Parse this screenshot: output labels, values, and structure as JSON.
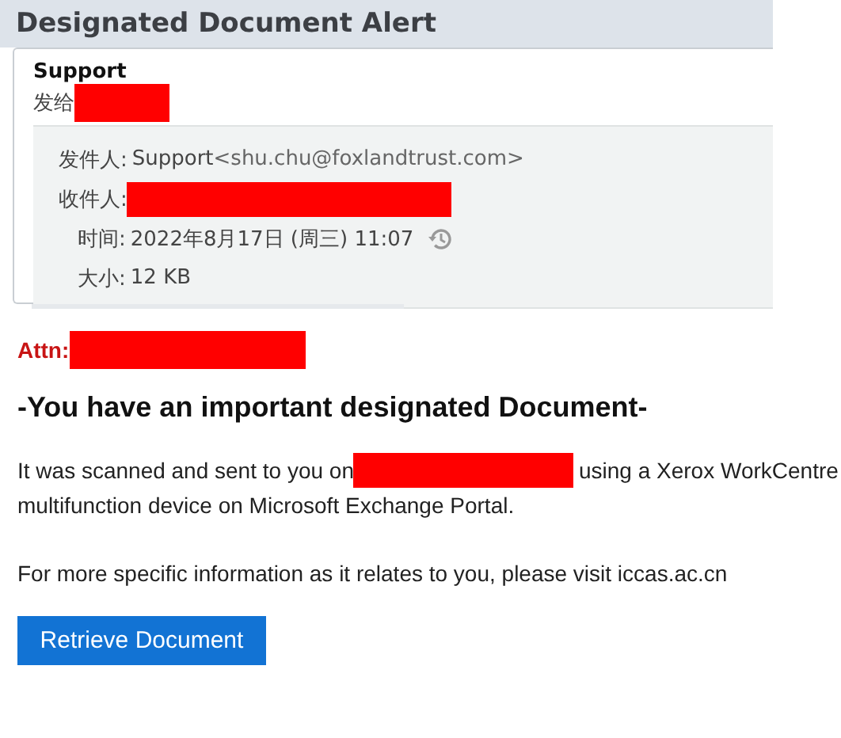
{
  "subject": "Designated Document Alert",
  "sender_name": "Support",
  "to_label": "发给",
  "details": [
    {
      "kind": "from",
      "label": "发件人:",
      "value": "Support",
      "extra": "<shu.chu@foxlandtrust.com>"
    },
    {
      "kind": "redacted",
      "label": "收件人:"
    },
    {
      "kind": "time",
      "label": "时间:",
      "value": "2022年8月17日 (周三) 11:07"
    },
    {
      "kind": "plain",
      "label": "大小:",
      "value": "12 KB"
    }
  ],
  "body": {
    "attn_label": "Attn:",
    "heading": "-You have an important designated Document-",
    "scan_before": "It was scanned and sent to you on",
    "scan_after": "using a Xerox WorkCentre",
    "scan_line2": "multifunction device on Microsoft Exchange Portal.",
    "info": "For more specific information as it relates to you, please visit iccas.ac.cn",
    "button": "Retrieve Document"
  }
}
